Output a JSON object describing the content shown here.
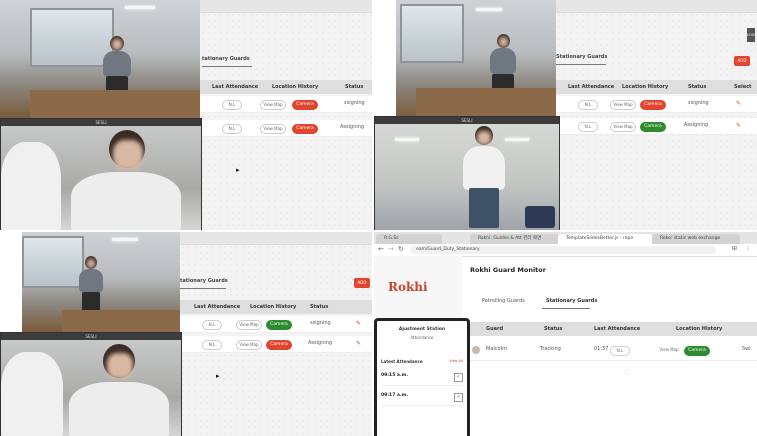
{
  "quadrant_1": {
    "section_title": "tationary Guards",
    "columns": [
      "Last Attendance",
      "Location History",
      "Status"
    ],
    "rows": [
      {
        "attendance": "N.L",
        "location": "View Map",
        "camera": "Camera",
        "camera_color": "#e2452e",
        "status": "ssigning"
      },
      {
        "attendance": "N.L",
        "location": "View Map",
        "camera": "Camera",
        "camera_color": "#e2452e",
        "status": "Assigning"
      }
    ],
    "call_title": "SESLI"
  },
  "quadrant_2": {
    "section_title": "Stationary Guards",
    "columns": [
      "Last Attendance",
      "Location History",
      "Status",
      "Select"
    ],
    "rows": [
      {
        "attendance": "N.L",
        "location": "View Map",
        "camera": "Camera",
        "camera_color": "#e2452e",
        "status": "ssigning"
      },
      {
        "attendance": "N.L",
        "location": "View Map",
        "camera": "Camera",
        "camera_color": "#2e8b2e",
        "status": "Assigning"
      }
    ],
    "side_button": "LOGO",
    "add_button": "ADD",
    "call_title": "SESLI"
  },
  "quadrant_3": {
    "section_title": "tationary Guards",
    "columns": [
      "Last Attendance",
      "Location History",
      "Status"
    ],
    "rows": [
      {
        "attendance": "N.L",
        "location": "View Map",
        "camera": "Camera",
        "camera_color": "#2e8b2e",
        "status": "ssigning"
      },
      {
        "attendance": "N.L",
        "location": "View Map",
        "camera": "Camera",
        "camera_color": "#e2452e",
        "status": "Assigning"
      }
    ],
    "add_button": "ADD",
    "call_title": "SESLI"
  },
  "quadrant_4": {
    "browser_tabs": [
      "R.G.Ss",
      "Rokhi: Guides & Att 관리 화면",
      "TemplateSlidesBetter.js - repo",
      "Reko: static web exchange"
    ],
    "url": "eam/Guard_Duty_Stationary",
    "brand": "Rokhi",
    "page_title": "Rokhi Guard Monitor",
    "tabs": [
      "Patrolling Guards",
      "Stationary Guards"
    ],
    "columns": [
      "Guard",
      "Status",
      "Last Attendance",
      "Location History"
    ],
    "row": {
      "guard": "Malcolm",
      "status": "Tracking",
      "attendance_time": "01:37",
      "attendance_pill": "N.L",
      "location": "View Map",
      "camera": "Camera",
      "camera_color": "#2e8b2e",
      "extra": "Swi"
    },
    "phone": {
      "header": "Ajustment Station",
      "subheader": "Attendance",
      "list_title": "Latest Attendance",
      "list_link": "View All",
      "items": [
        {
          "time": "09:15 a.m."
        },
        {
          "time": "09:17 a.m."
        }
      ]
    }
  }
}
